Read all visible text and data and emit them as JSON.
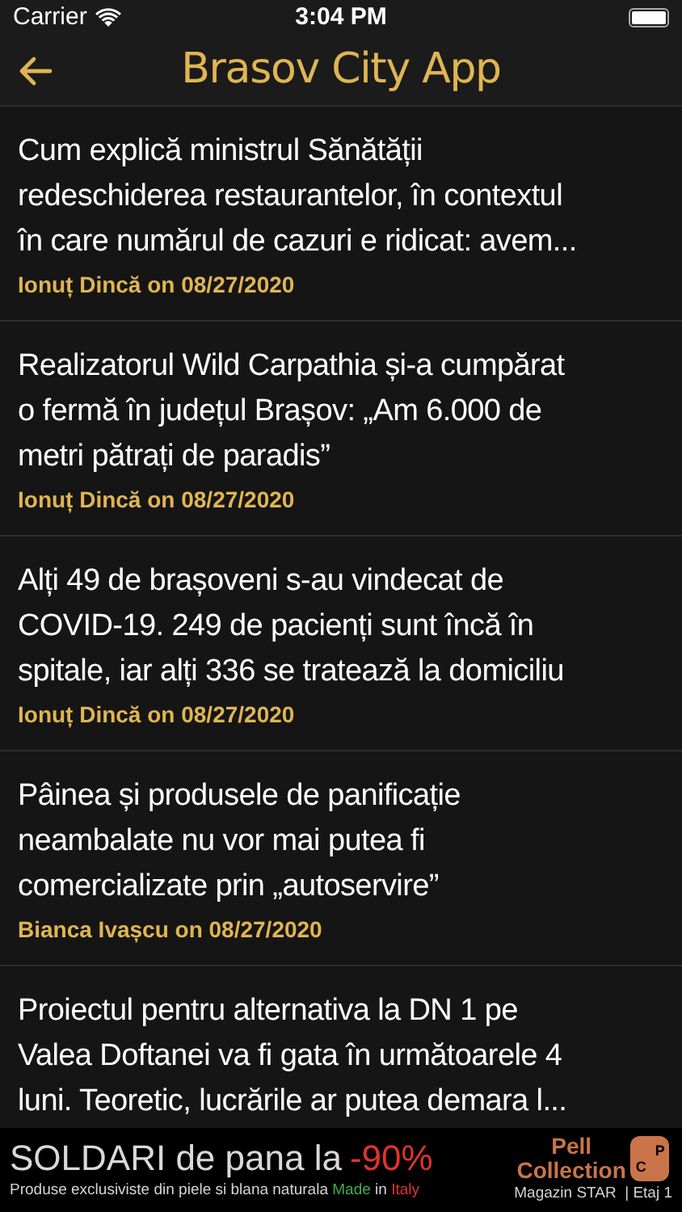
{
  "status_bar": {
    "carrier": "Carrier",
    "time": "3:04 PM"
  },
  "nav": {
    "title": "Brasov City App"
  },
  "articles": [
    {
      "title_lines": [
        "Cum explică ministrul Sănătății",
        "redeschiderea restaurantelor, în contextul",
        "în care numărul de cazuri e ridicat: avem..."
      ],
      "byline": "Ionuț Dincă on 08/27/2020"
    },
    {
      "title_lines": [
        "Realizatorul Wild Carpathia și-a cumpărat",
        "o fermă în județul Brașov: „Am 6.000 de",
        "metri pătrați de paradis”"
      ],
      "byline": "Ionuț Dincă on 08/27/2020"
    },
    {
      "title_lines": [
        "Alți 49 de brașoveni s-au vindecat de",
        "COVID-19. 249 de pacienți sunt încă în",
        "spitale, iar alți 336 se tratează la domiciliu"
      ],
      "byline": "Ionuț Dincă on 08/27/2020"
    },
    {
      "title_lines": [
        "Pâinea și produsele de panificație",
        "neambalate nu vor mai putea fi",
        "comercializate prin „autoservire”"
      ],
      "byline": "Bianca Ivașcu on 08/27/2020"
    },
    {
      "title_lines": [
        "Proiectul pentru alternativa la DN 1 pe",
        "Valea Doftanei va fi gata în următoarele 4",
        "luni. Teoretic, lucrările ar putea demara l..."
      ]
    }
  ],
  "ad": {
    "headline": "SOLDARI de pana la",
    "discount": "-90%",
    "tagline": [
      {
        "text": "Produse exclusiviste din piele si blana naturala",
        "color": "#d4d4d4"
      },
      {
        "text": "Made",
        "color": "#3fae49"
      },
      {
        "text": "in",
        "color": "#d4d4d4"
      },
      {
        "text": "Italy",
        "color": "#e0332c"
      }
    ],
    "brand_top": "Pell",
    "brand_bottom": "Collection",
    "logo_letters": [
      "P",
      "C"
    ],
    "store": "Magazin STAR  | Etaj 1"
  }
}
